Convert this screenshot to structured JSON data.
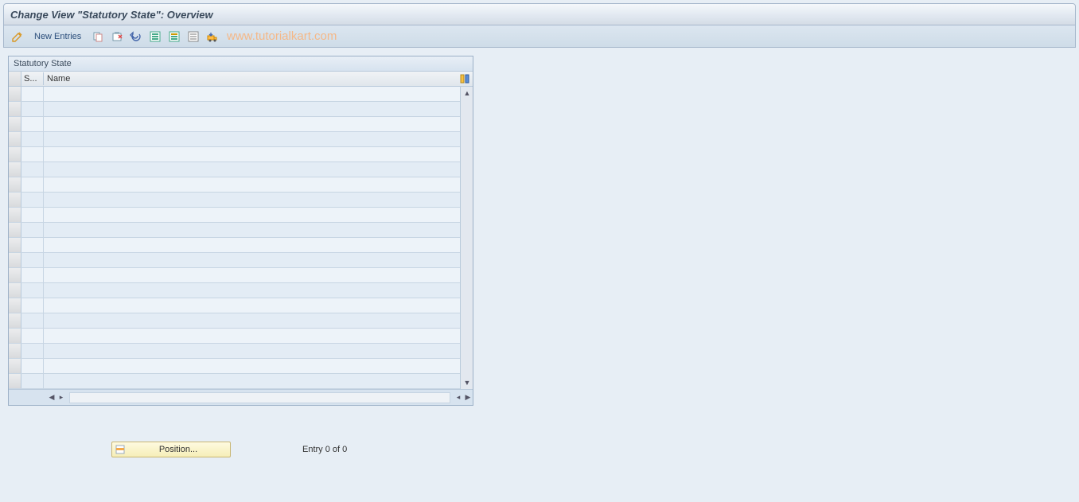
{
  "header": {
    "title": "Change View \"Statutory State\": Overview"
  },
  "toolbar": {
    "new_entries_label": "New Entries"
  },
  "watermark": "www.tutorialkart.com",
  "table": {
    "title": "Statutory State",
    "columns": {
      "s": "S...",
      "name": "Name"
    },
    "row_count": 20
  },
  "footer": {
    "position_label": "Position...",
    "entry_status": "Entry 0 of 0"
  }
}
